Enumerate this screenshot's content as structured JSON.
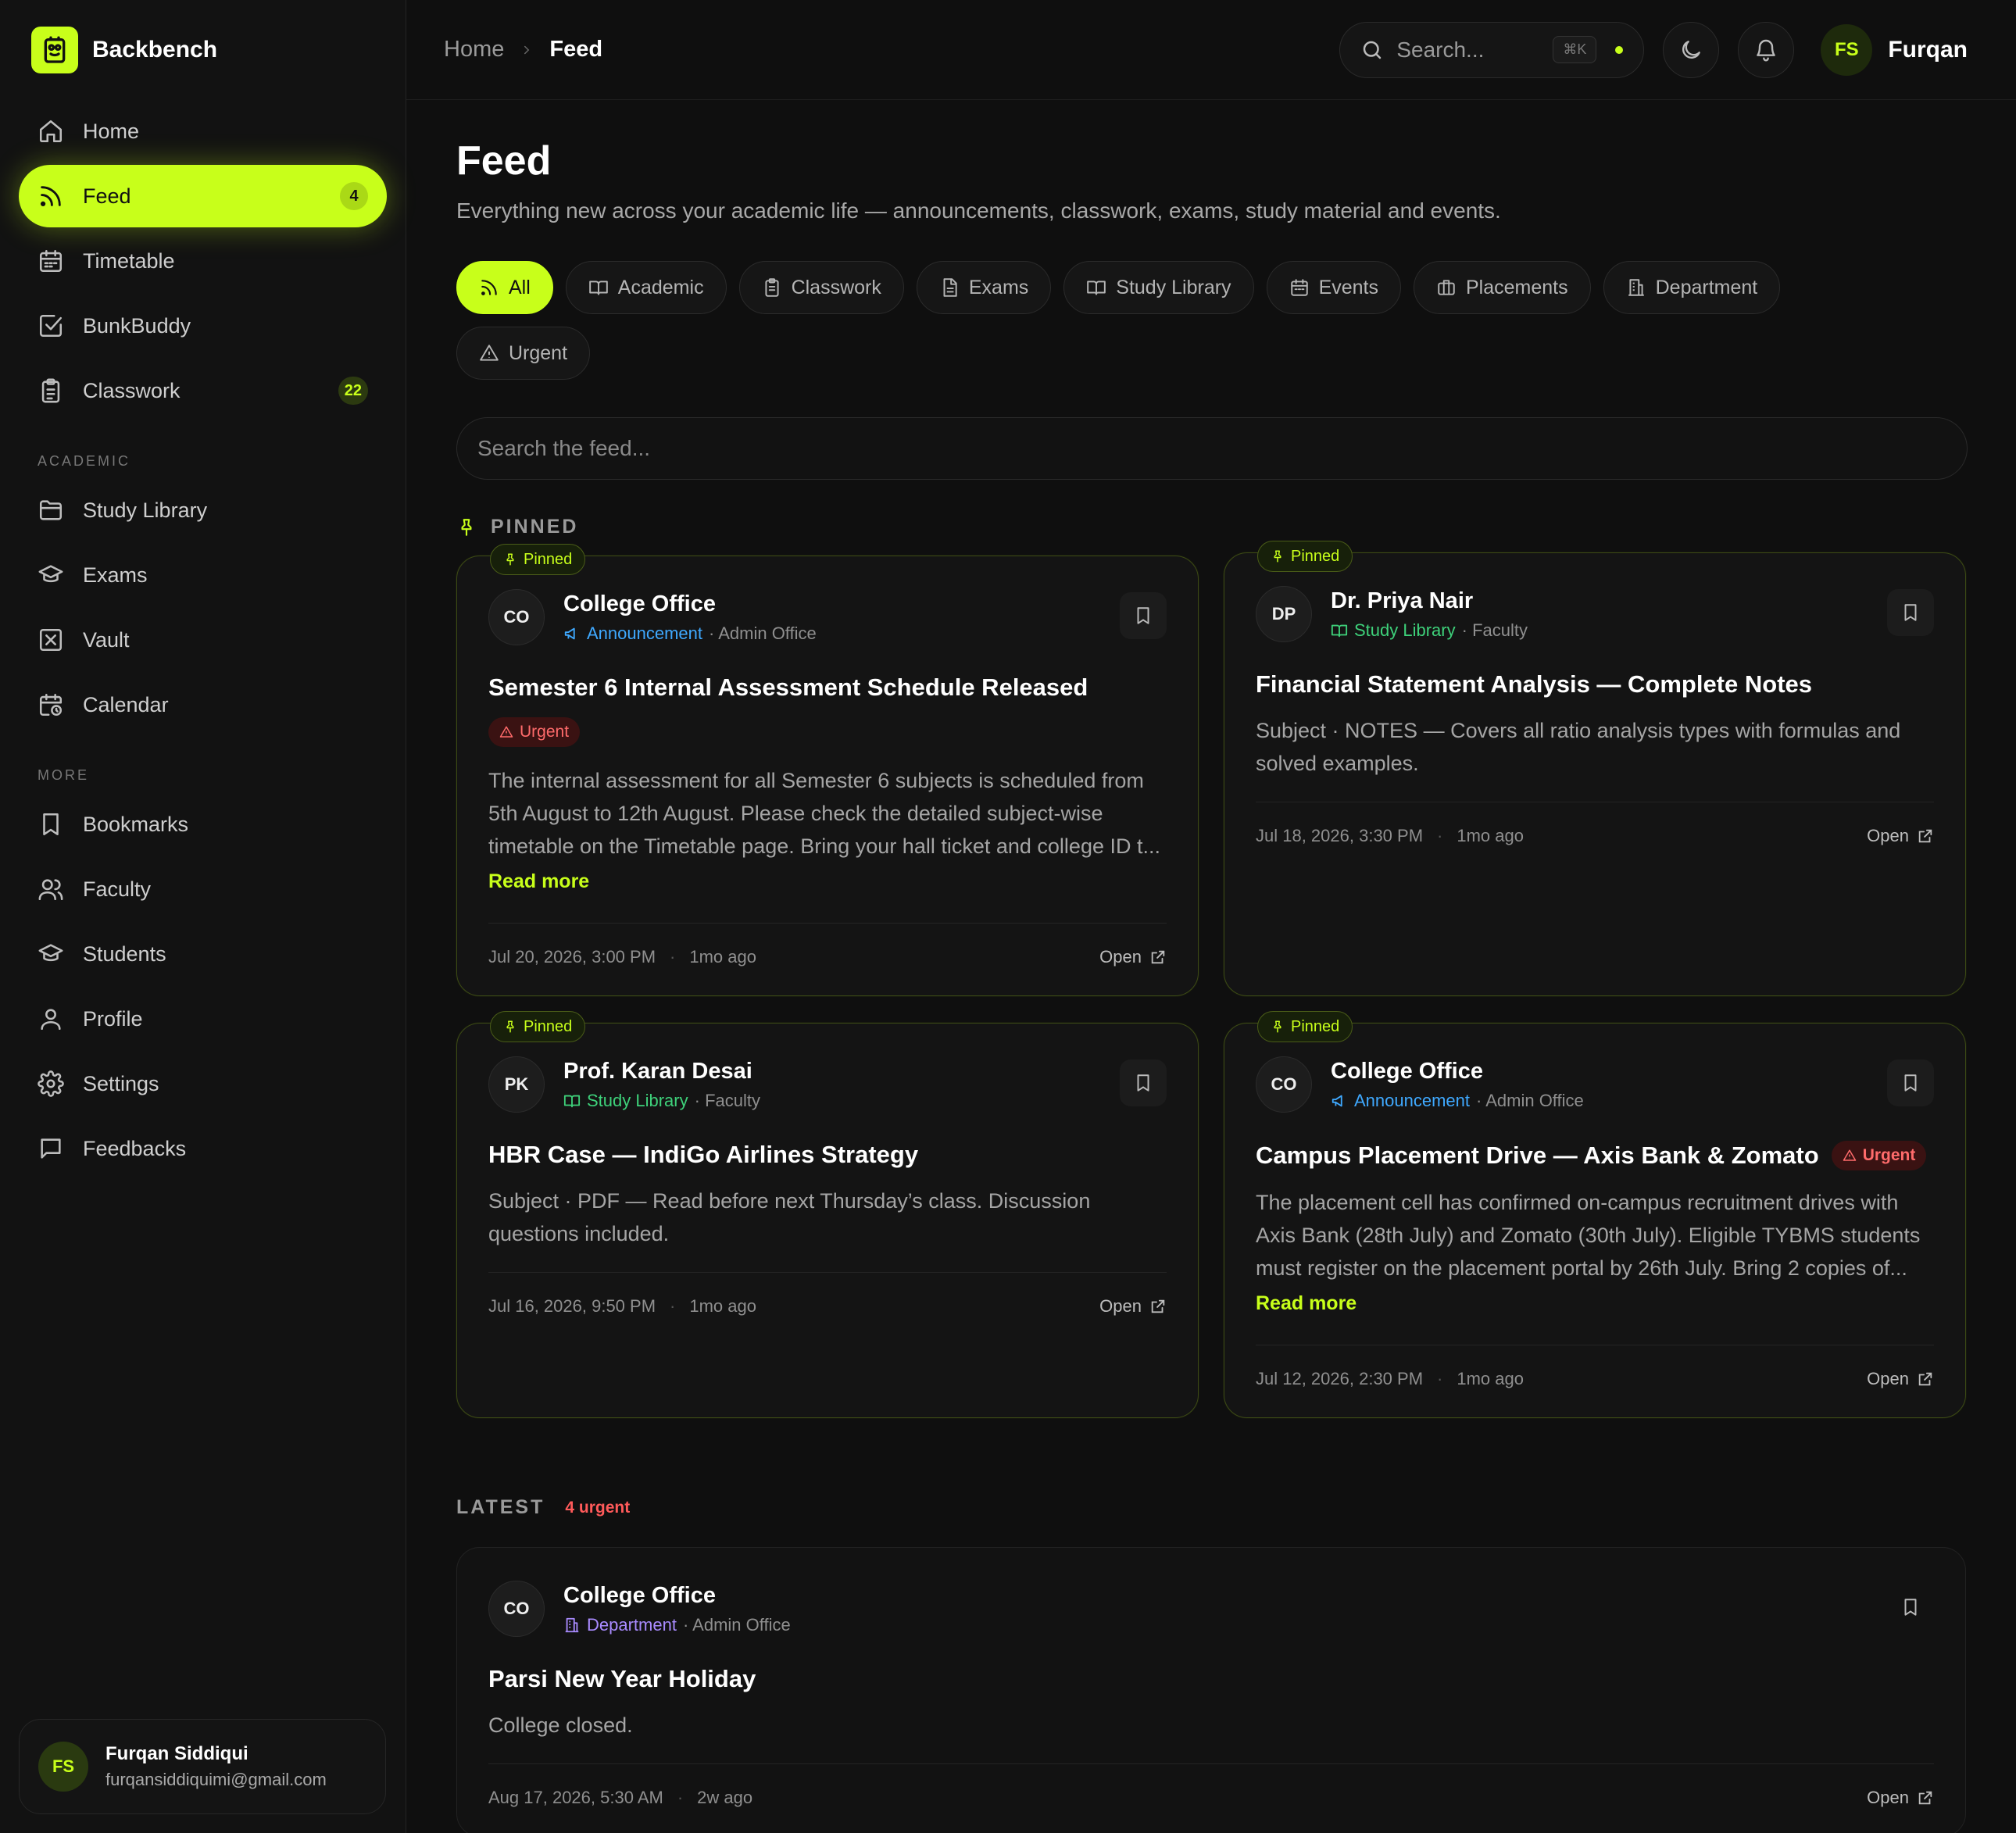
{
  "brand": {
    "name": "Backbench"
  },
  "sidebar": {
    "main_items": [
      {
        "label": "Home",
        "icon": "home-icon"
      },
      {
        "label": "Feed",
        "icon": "rss-icon",
        "badge": "4",
        "active": true
      },
      {
        "label": "Timetable",
        "icon": "calendar-grid-icon"
      },
      {
        "label": "BunkBuddy",
        "icon": "check-square-icon"
      },
      {
        "label": "Classwork",
        "icon": "clipboard-icon",
        "badge": "22"
      }
    ],
    "academic_label": "ACADEMIC",
    "academic_items": [
      {
        "label": "Study Library",
        "icon": "folder-icon"
      },
      {
        "label": "Exams",
        "icon": "graduation-cap-icon"
      },
      {
        "label": "Vault",
        "icon": "vault-icon"
      },
      {
        "label": "Calendar",
        "icon": "calendar-clock-icon"
      }
    ],
    "more_label": "MORE",
    "more_items": [
      {
        "label": "Bookmarks",
        "icon": "bookmark-icon"
      },
      {
        "label": "Faculty",
        "icon": "users-icon"
      },
      {
        "label": "Students",
        "icon": "graduation-cap-icon"
      },
      {
        "label": "Profile",
        "icon": "user-icon"
      },
      {
        "label": "Settings",
        "icon": "gear-icon"
      },
      {
        "label": "Feedbacks",
        "icon": "message-icon"
      }
    ],
    "user": {
      "initials": "FS",
      "name": "Furqan Siddiqui",
      "email": "furqansiddiquimi@gmail.com"
    }
  },
  "topbar": {
    "breadcrumb": {
      "home": "Home",
      "current": "Feed"
    },
    "search_placeholder": "Search...",
    "shortcut": "⌘K",
    "user_initials": "FS",
    "user_name": "Furqan"
  },
  "page": {
    "title": "Feed",
    "subtitle": "Everything new across your academic life — announcements, classwork, exams, study material and events.",
    "filters": [
      {
        "label": "All",
        "icon": "rss-icon",
        "active": true
      },
      {
        "label": "Academic",
        "icon": "book-open-icon"
      },
      {
        "label": "Classwork",
        "icon": "clipboard-icon"
      },
      {
        "label": "Exams",
        "icon": "file-text-icon"
      },
      {
        "label": "Study Library",
        "icon": "book-open-icon"
      },
      {
        "label": "Events",
        "icon": "calendar-grid-icon"
      },
      {
        "label": "Placements",
        "icon": "briefcase-icon"
      },
      {
        "label": "Department",
        "icon": "building-icon"
      },
      {
        "label": "Urgent",
        "icon": "alert-triangle-icon"
      }
    ],
    "feed_search_placeholder": "Search the feed..."
  },
  "pinned": {
    "label": "PINNED",
    "tag": "Pinned",
    "cards": [
      {
        "initials": "CO",
        "author": "College Office",
        "category": "Announcement",
        "category_color": "#3fa9ff",
        "role": "· Admin Office",
        "title": "Semester 6 Internal Assessment Schedule Released",
        "urgent": "Urgent",
        "body": "The internal assessment for all Semester 6 subjects is scheduled from 5th August to 12th August. Please check the detailed subject-wise timetable on the Timetable page. Bring your hall ticket and college ID t...",
        "read_more": "Read more",
        "date": "Jul 20, 2026, 3:00 PM",
        "ago": "1mo ago",
        "open": "Open"
      },
      {
        "initials": "DP",
        "author": "Dr. Priya Nair",
        "category": "Study Library",
        "category_color": "#3ed17a",
        "role": "· Faculty",
        "title": "Financial Statement Analysis — Complete Notes",
        "body": "Subject · NOTES — Covers all ratio analysis types with formulas and solved examples.",
        "date": "Jul 18, 2026, 3:30 PM",
        "ago": "1mo ago",
        "open": "Open"
      },
      {
        "initials": "PK",
        "author": "Prof. Karan Desai",
        "category": "Study Library",
        "category_color": "#3ed17a",
        "role": "· Faculty",
        "title": "HBR Case — IndiGo Airlines Strategy",
        "body": "Subject · PDF — Read before next Thursday’s class. Discussion questions included.",
        "date": "Jul 16, 2026, 9:50 PM",
        "ago": "1mo ago",
        "open": "Open"
      },
      {
        "initials": "CO",
        "author": "College Office",
        "category": "Announcement",
        "category_color": "#3fa9ff",
        "role": "· Admin Office",
        "title": "Campus Placement Drive — Axis Bank & Zomato",
        "urgent": "Urgent",
        "body": "The placement cell has confirmed on-campus recruitment drives with Axis Bank (28th July) and Zomato (30th July). Eligible TYBMS students must register on the placement portal by 26th July. Bring 2 copies of...",
        "read_more": "Read more",
        "date": "Jul 12, 2026, 2:30 PM",
        "ago": "1mo ago",
        "open": "Open"
      }
    ]
  },
  "latest": {
    "label": "LATEST",
    "urgent_count": "4 urgent",
    "cards": [
      {
        "initials": "CO",
        "author": "College Office",
        "category": "Department",
        "category_color": "#a98bff",
        "role": "· Admin Office",
        "title": "Parsi New Year Holiday",
        "body": "College closed.",
        "date": "Aug 17, 2026, 5:30 AM",
        "ago": "2w ago",
        "open": "Open"
      }
    ]
  },
  "colors": {
    "accent": "#c8ff1a",
    "urgent": "#ff6b6b",
    "announcement": "#3fa9ff",
    "study_library": "#3ed17a",
    "department": "#a98bff"
  }
}
